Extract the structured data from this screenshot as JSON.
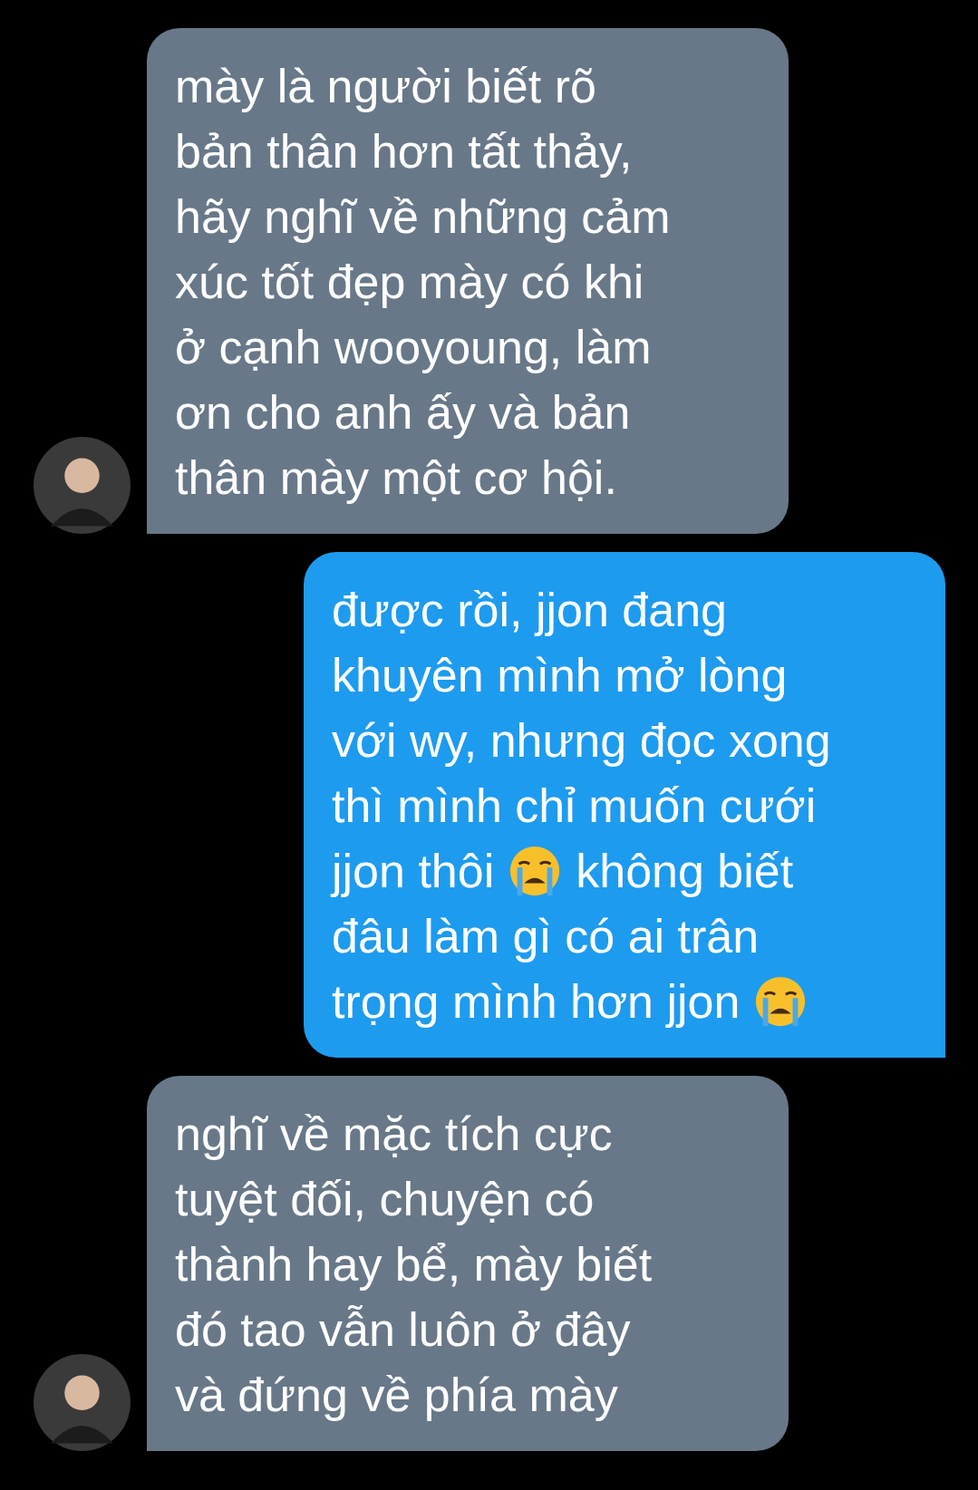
{
  "messages": [
    {
      "kind": "received",
      "blocks": [
        [
          {
            "kind": "text",
            "text": "mày là người biết rõ\nbản thân hơn tất thảy,\nhãy nghĩ về những cảm\nxúc tốt đẹp mày có khi\nở cạnh wooyoung, làm\nơn cho anh ấy và bản\nthân mày một cơ hội."
          }
        ]
      ]
    },
    {
      "kind": "sent",
      "blocks": [
        [
          {
            "kind": "text",
            "text": "được rồi, jjon đang\nkhuyên mình mở lòng\nvới wy, nhưng đọc xong\nthì mình chỉ muốn cưới"
          }
        ],
        [
          {
            "kind": "text",
            "text": "jjon thôi"
          },
          {
            "kind": "emoji"
          },
          {
            "kind": "text",
            "text": "không biết"
          }
        ],
        [
          {
            "kind": "text",
            "text": "đâu làm gì có ai trân"
          }
        ],
        [
          {
            "kind": "text",
            "text": "trọng mình hơn jjon"
          },
          {
            "kind": "emoji"
          }
        ]
      ]
    },
    {
      "kind": "received",
      "blocks": [
        [
          {
            "kind": "text",
            "text": "nghĩ về mặc tích cực\ntuyệt đối, chuyện có\nthành hay bể, mày biết\nđó tao vẫn luôn ở đây\nvà đứng về phía mày"
          }
        ]
      ]
    }
  ]
}
